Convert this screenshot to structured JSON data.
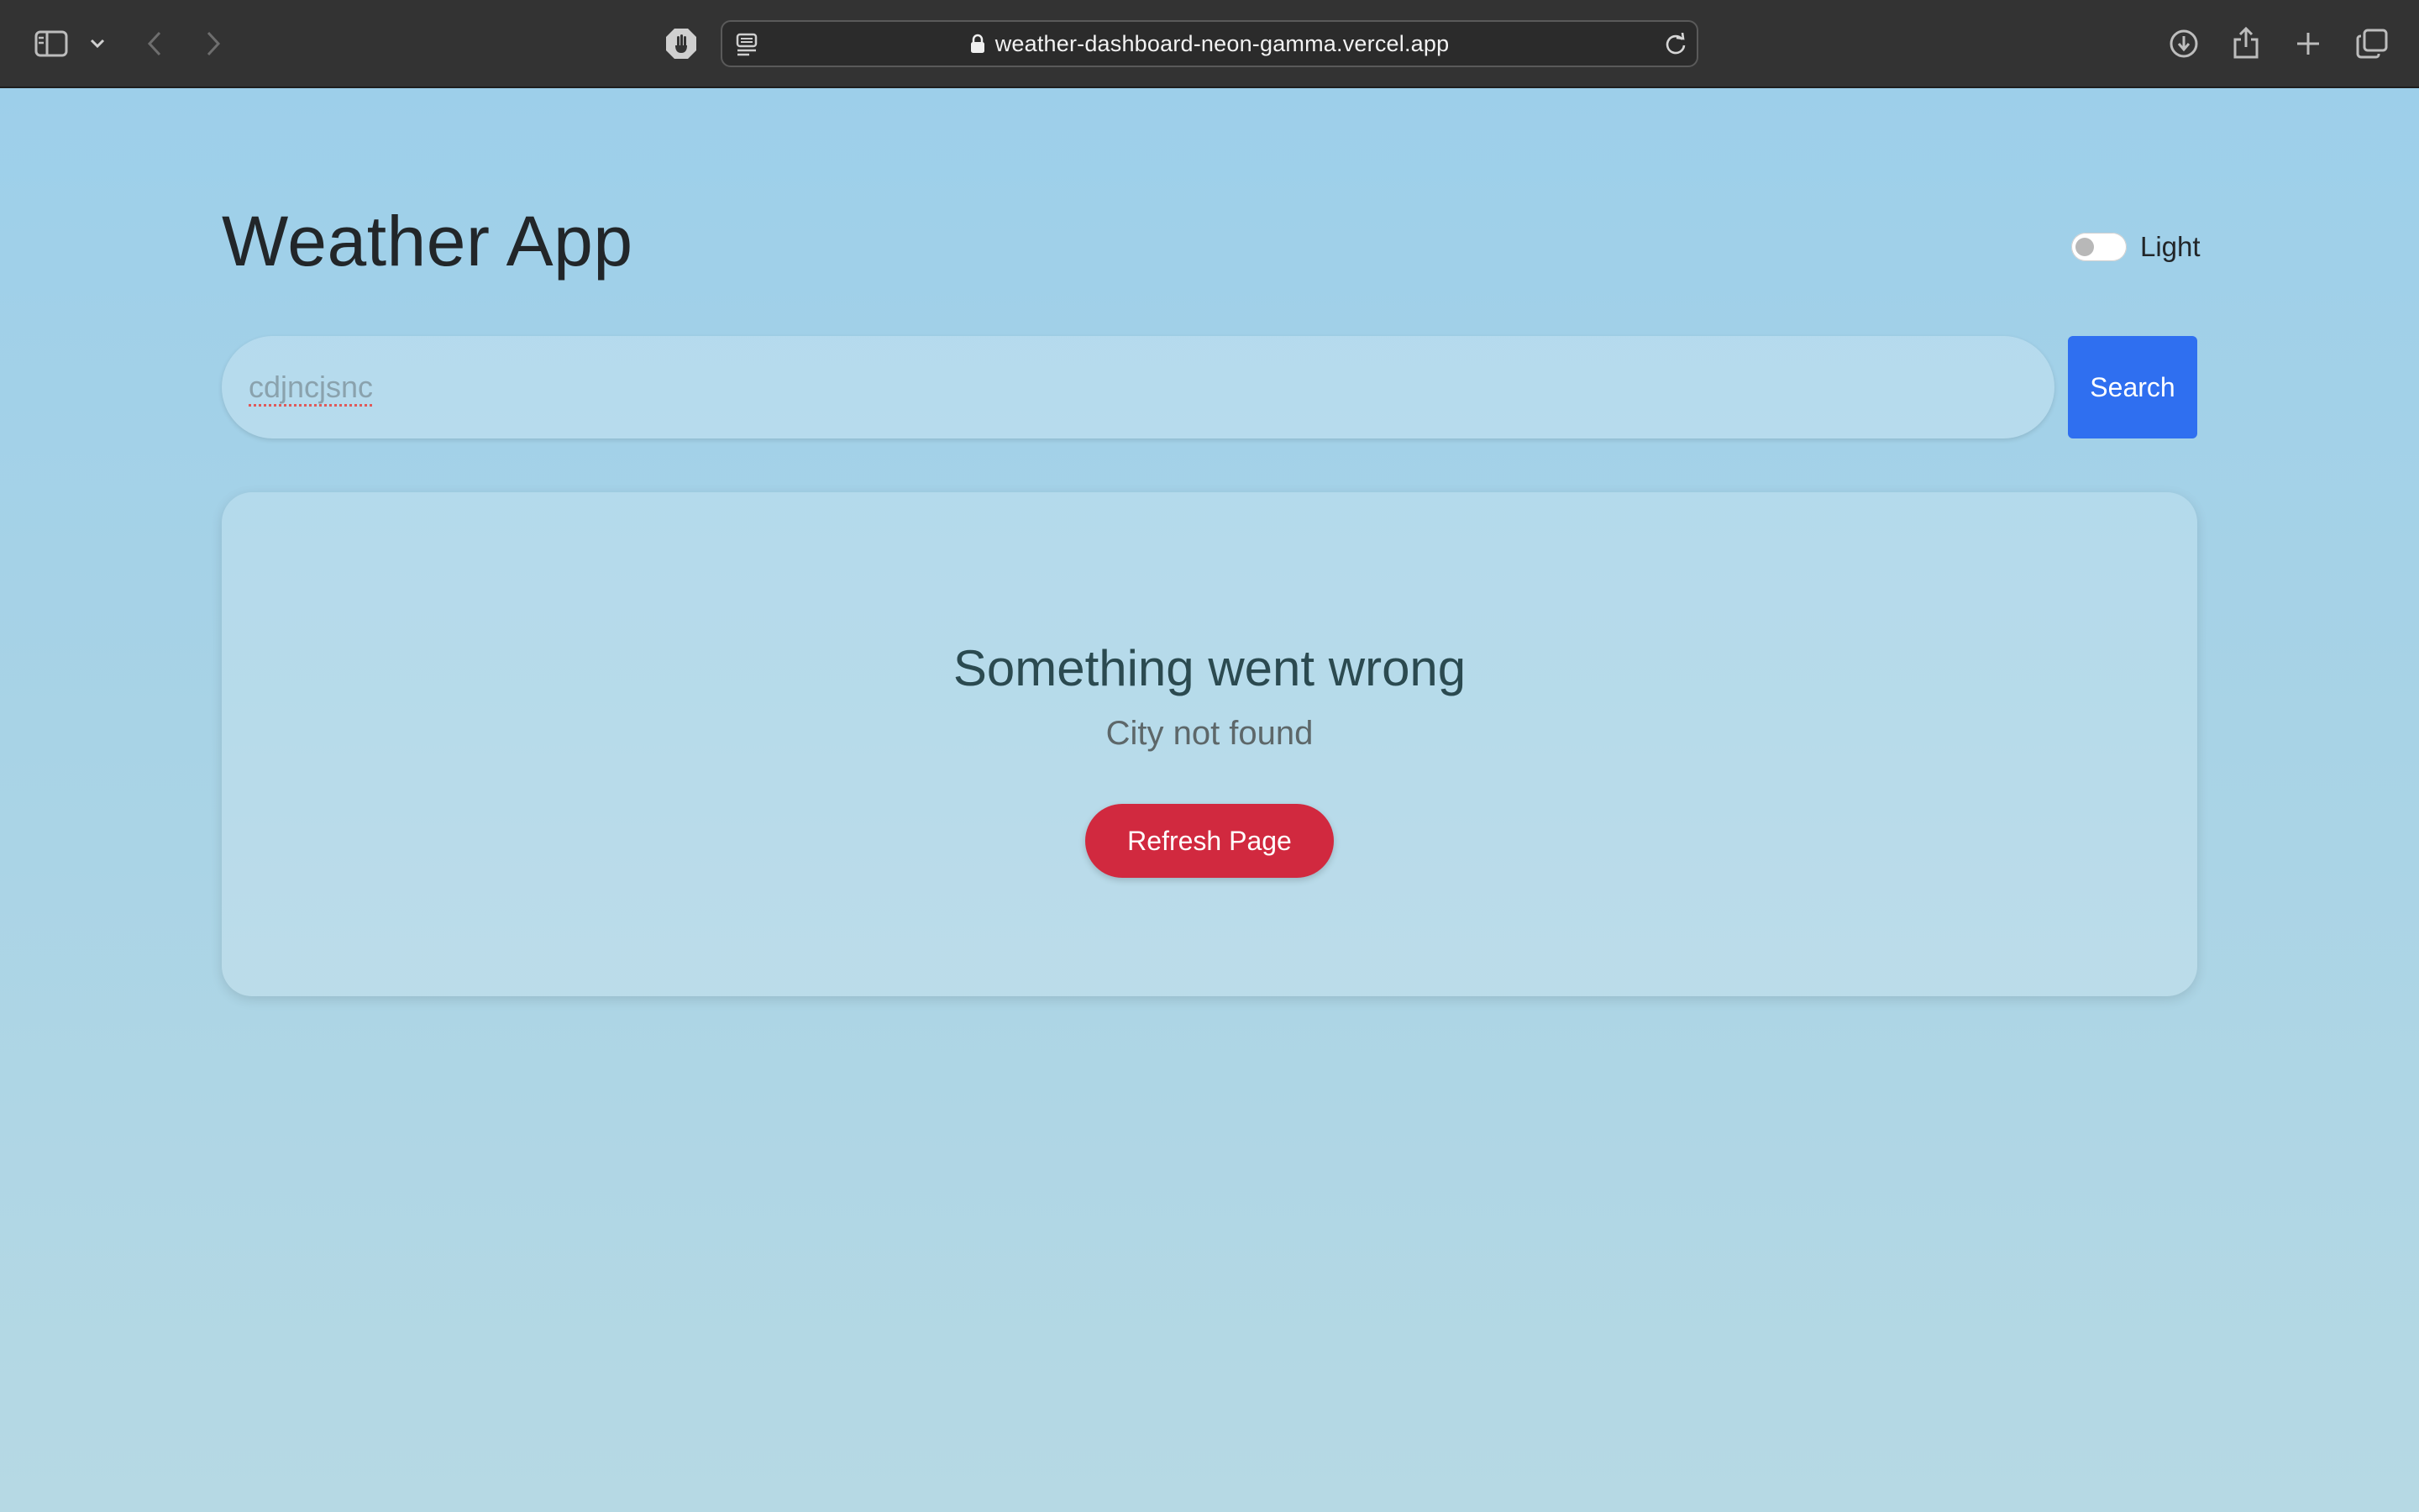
{
  "browser": {
    "url": "weather-dashboard-neon-gamma.vercel.app",
    "icons": {
      "sidebar": "sidebar-icon",
      "tab_menu": "chevron-down-icon",
      "back": "chevron-left-icon",
      "forward": "chevron-right-icon",
      "privacy": "shield-hand-icon",
      "reader": "reader-icon",
      "lock": "lock-icon",
      "reload": "reload-icon",
      "downloads": "download-icon",
      "share": "share-icon",
      "new_tab": "plus-icon",
      "tab_overview": "tabs-icon"
    }
  },
  "app": {
    "title": "Weather App",
    "theme_toggle": {
      "label": "Light",
      "enabled": false
    },
    "search": {
      "value": "cdjncjsnc",
      "button_label": "Search"
    },
    "error": {
      "heading": "Something went wrong",
      "message": "City not found",
      "button_label": "Refresh Page"
    }
  },
  "colors": {
    "accent_blue": "#2f6ff0",
    "error_red": "#d1293f",
    "background": "#a8d3e6"
  }
}
